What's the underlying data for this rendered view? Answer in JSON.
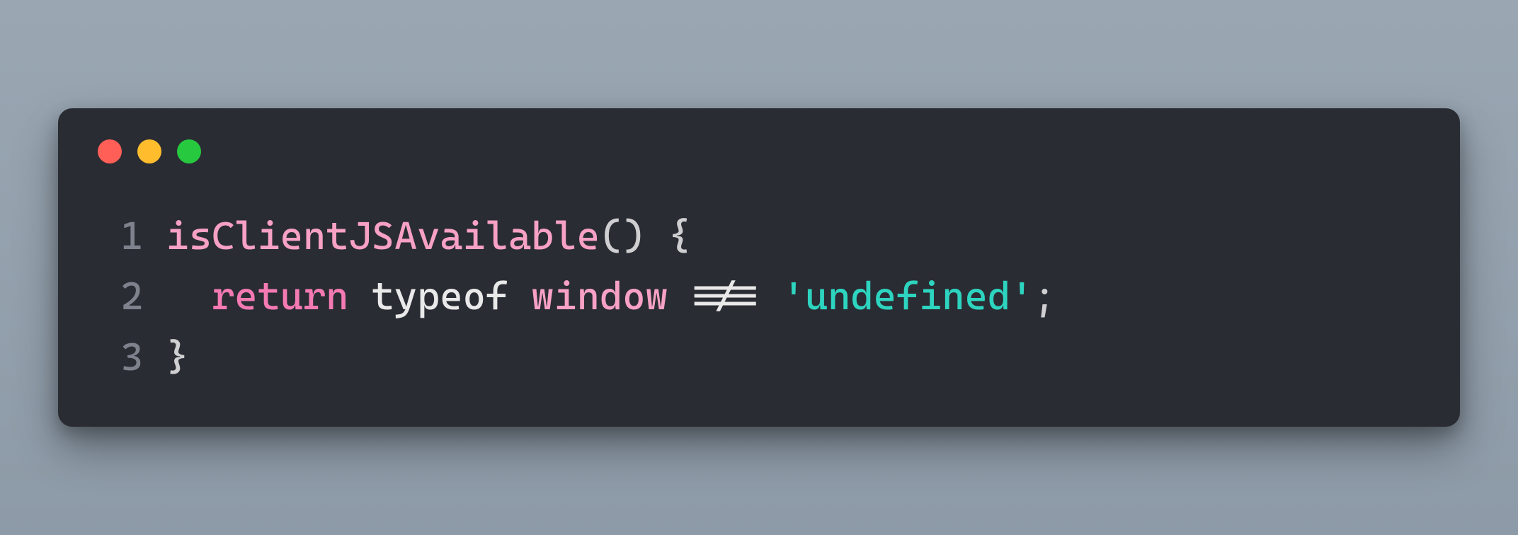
{
  "window": {
    "controls": [
      "close",
      "minimize",
      "zoom"
    ]
  },
  "code": {
    "lines": [
      {
        "num": "1",
        "tokens": [
          {
            "cls": "tok-fn",
            "text": "isClientJSAvailable"
          },
          {
            "cls": "tok-punc",
            "text": "() {"
          }
        ]
      },
      {
        "num": "2",
        "tokens": [
          {
            "cls": "tok-plain",
            "text": "  "
          },
          {
            "cls": "tok-kw",
            "text": "return"
          },
          {
            "cls": "tok-plain",
            "text": " typeof "
          },
          {
            "cls": "tok-fn",
            "text": "window"
          },
          {
            "cls": "tok-plain",
            "text": " !== "
          },
          {
            "cls": "tok-str",
            "text": "'undefined'"
          },
          {
            "cls": "tok-punc",
            "text": ";"
          }
        ]
      },
      {
        "num": "3",
        "tokens": [
          {
            "cls": "tok-punc",
            "text": "}"
          }
        ]
      }
    ]
  },
  "colors": {
    "bg": "#2a2c33",
    "fn": "#f7a1c4",
    "kw": "#f47ab3",
    "str": "#2dd4bf",
    "punc": "#cfcfd2",
    "lineno": "#7e828c",
    "dots": {
      "red": "#ff5f56",
      "yellow": "#ffbd2e",
      "green": "#27c93f"
    }
  }
}
